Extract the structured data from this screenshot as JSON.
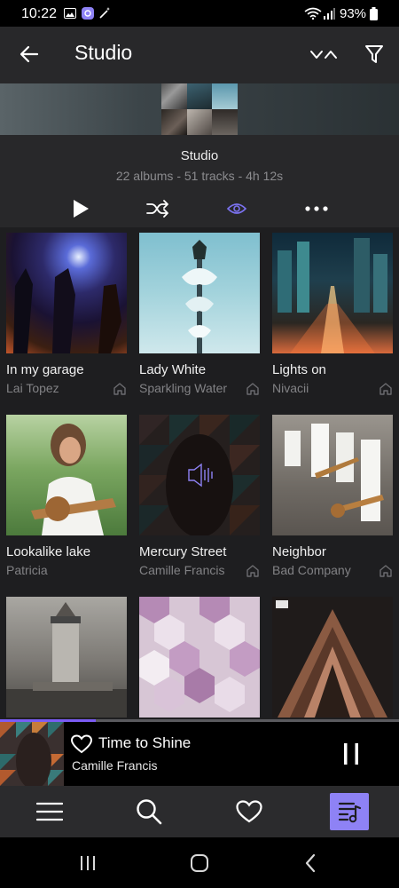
{
  "status": {
    "time": "10:22",
    "battery": "93%"
  },
  "appbar": {
    "title": "Studio"
  },
  "header": {
    "name": "Studio",
    "stats": "22 albums - 51 tracks - 4h 12s"
  },
  "albums": [
    {
      "title": "In my garage",
      "artist": "Lai Topez"
    },
    {
      "title": "Lady White",
      "artist": "Sparkling Water"
    },
    {
      "title": "Lights on",
      "artist": "Nivacii"
    },
    {
      "title": "Lookalike lake",
      "artist": "Patricia"
    },
    {
      "title": "Mercury Street",
      "artist": "Camille Francis"
    },
    {
      "title": "Neighbor",
      "artist": "Bad Company"
    },
    {
      "title": "",
      "artist": ""
    },
    {
      "title": "",
      "artist": ""
    },
    {
      "title": "",
      "artist": ""
    }
  ],
  "now_playing": {
    "title": "Time to Shine",
    "artist": "Camille Francis",
    "progress": 0.24
  },
  "colors": {
    "accent": "#7b5cf5",
    "active_nav_bg": "#8e82f5"
  }
}
